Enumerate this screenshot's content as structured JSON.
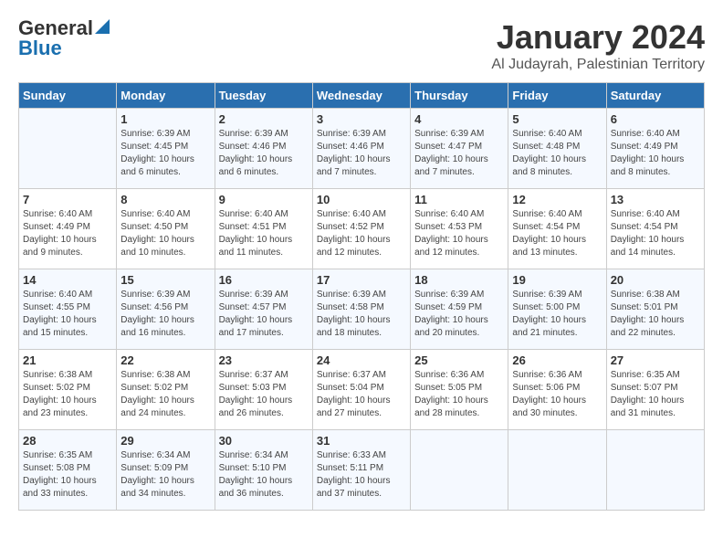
{
  "logo": {
    "general": "General",
    "blue": "Blue"
  },
  "title": {
    "month": "January 2024",
    "location": "Al Judayrah, Palestinian Territory"
  },
  "headers": [
    "Sunday",
    "Monday",
    "Tuesday",
    "Wednesday",
    "Thursday",
    "Friday",
    "Saturday"
  ],
  "weeks": [
    [
      {
        "day": "",
        "info": ""
      },
      {
        "day": "1",
        "info": "Sunrise: 6:39 AM\nSunset: 4:45 PM\nDaylight: 10 hours\nand 6 minutes."
      },
      {
        "day": "2",
        "info": "Sunrise: 6:39 AM\nSunset: 4:46 PM\nDaylight: 10 hours\nand 6 minutes."
      },
      {
        "day": "3",
        "info": "Sunrise: 6:39 AM\nSunset: 4:46 PM\nDaylight: 10 hours\nand 7 minutes."
      },
      {
        "day": "4",
        "info": "Sunrise: 6:39 AM\nSunset: 4:47 PM\nDaylight: 10 hours\nand 7 minutes."
      },
      {
        "day": "5",
        "info": "Sunrise: 6:40 AM\nSunset: 4:48 PM\nDaylight: 10 hours\nand 8 minutes."
      },
      {
        "day": "6",
        "info": "Sunrise: 6:40 AM\nSunset: 4:49 PM\nDaylight: 10 hours\nand 8 minutes."
      }
    ],
    [
      {
        "day": "7",
        "info": "Sunrise: 6:40 AM\nSunset: 4:49 PM\nDaylight: 10 hours\nand 9 minutes."
      },
      {
        "day": "8",
        "info": "Sunrise: 6:40 AM\nSunset: 4:50 PM\nDaylight: 10 hours\nand 10 minutes."
      },
      {
        "day": "9",
        "info": "Sunrise: 6:40 AM\nSunset: 4:51 PM\nDaylight: 10 hours\nand 11 minutes."
      },
      {
        "day": "10",
        "info": "Sunrise: 6:40 AM\nSunset: 4:52 PM\nDaylight: 10 hours\nand 12 minutes."
      },
      {
        "day": "11",
        "info": "Sunrise: 6:40 AM\nSunset: 4:53 PM\nDaylight: 10 hours\nand 12 minutes."
      },
      {
        "day": "12",
        "info": "Sunrise: 6:40 AM\nSunset: 4:54 PM\nDaylight: 10 hours\nand 13 minutes."
      },
      {
        "day": "13",
        "info": "Sunrise: 6:40 AM\nSunset: 4:54 PM\nDaylight: 10 hours\nand 14 minutes."
      }
    ],
    [
      {
        "day": "14",
        "info": "Sunrise: 6:40 AM\nSunset: 4:55 PM\nDaylight: 10 hours\nand 15 minutes."
      },
      {
        "day": "15",
        "info": "Sunrise: 6:39 AM\nSunset: 4:56 PM\nDaylight: 10 hours\nand 16 minutes."
      },
      {
        "day": "16",
        "info": "Sunrise: 6:39 AM\nSunset: 4:57 PM\nDaylight: 10 hours\nand 17 minutes."
      },
      {
        "day": "17",
        "info": "Sunrise: 6:39 AM\nSunset: 4:58 PM\nDaylight: 10 hours\nand 18 minutes."
      },
      {
        "day": "18",
        "info": "Sunrise: 6:39 AM\nSunset: 4:59 PM\nDaylight: 10 hours\nand 20 minutes."
      },
      {
        "day": "19",
        "info": "Sunrise: 6:39 AM\nSunset: 5:00 PM\nDaylight: 10 hours\nand 21 minutes."
      },
      {
        "day": "20",
        "info": "Sunrise: 6:38 AM\nSunset: 5:01 PM\nDaylight: 10 hours\nand 22 minutes."
      }
    ],
    [
      {
        "day": "21",
        "info": "Sunrise: 6:38 AM\nSunset: 5:02 PM\nDaylight: 10 hours\nand 23 minutes."
      },
      {
        "day": "22",
        "info": "Sunrise: 6:38 AM\nSunset: 5:02 PM\nDaylight: 10 hours\nand 24 minutes."
      },
      {
        "day": "23",
        "info": "Sunrise: 6:37 AM\nSunset: 5:03 PM\nDaylight: 10 hours\nand 26 minutes."
      },
      {
        "day": "24",
        "info": "Sunrise: 6:37 AM\nSunset: 5:04 PM\nDaylight: 10 hours\nand 27 minutes."
      },
      {
        "day": "25",
        "info": "Sunrise: 6:36 AM\nSunset: 5:05 PM\nDaylight: 10 hours\nand 28 minutes."
      },
      {
        "day": "26",
        "info": "Sunrise: 6:36 AM\nSunset: 5:06 PM\nDaylight: 10 hours\nand 30 minutes."
      },
      {
        "day": "27",
        "info": "Sunrise: 6:35 AM\nSunset: 5:07 PM\nDaylight: 10 hours\nand 31 minutes."
      }
    ],
    [
      {
        "day": "28",
        "info": "Sunrise: 6:35 AM\nSunset: 5:08 PM\nDaylight: 10 hours\nand 33 minutes."
      },
      {
        "day": "29",
        "info": "Sunrise: 6:34 AM\nSunset: 5:09 PM\nDaylight: 10 hours\nand 34 minutes."
      },
      {
        "day": "30",
        "info": "Sunrise: 6:34 AM\nSunset: 5:10 PM\nDaylight: 10 hours\nand 36 minutes."
      },
      {
        "day": "31",
        "info": "Sunrise: 6:33 AM\nSunset: 5:11 PM\nDaylight: 10 hours\nand 37 minutes."
      },
      {
        "day": "",
        "info": ""
      },
      {
        "day": "",
        "info": ""
      },
      {
        "day": "",
        "info": ""
      }
    ]
  ]
}
